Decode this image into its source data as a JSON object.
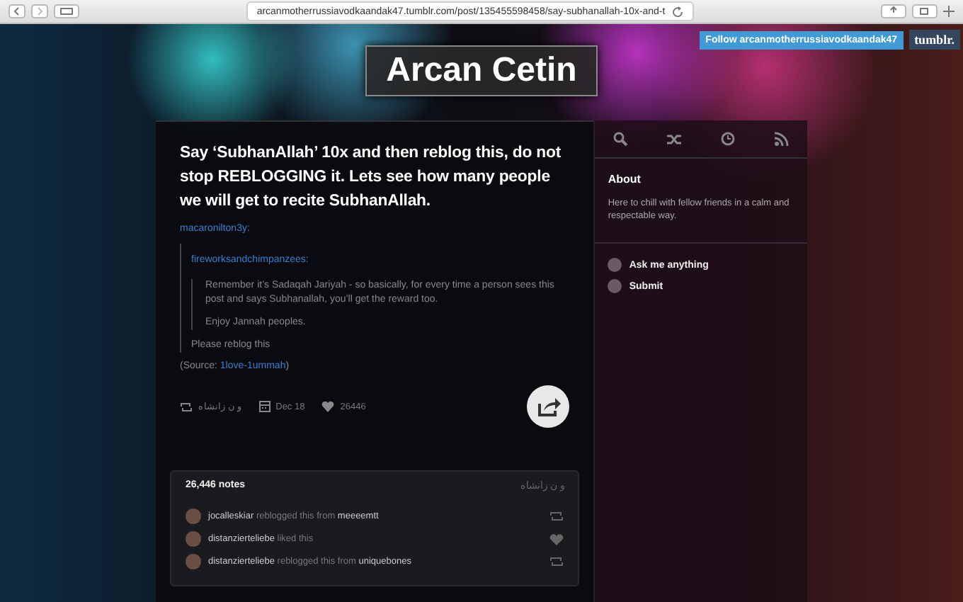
{
  "browser": {
    "url": "arcanmotherrussiavodkaandak47.tumblr.com/post/135455598458/say-subhanallah-10x-and-t"
  },
  "follow_bar": {
    "follow_label": "Follow arcanmotherrussiavodkaandak47",
    "brand": "tumblr."
  },
  "blog_title": "Arcan Cetin",
  "post": {
    "title": "Say ‘SubhanAllah’ 10x and then reblog this, do not stop REBLOGGING it. Lets see how many people we will get to recite SubhanAllah.",
    "reblogger": "macaronilton3y:",
    "quote": {
      "author": "fireworksandchimpanzees:",
      "paragraphs": [
        "Remember it’s Sadaqah Jariyah - so basically, for every time a person sees this post and says Subhanallah, you’ll get the reward too.",
        "Enjoy Jannah peoples."
      ]
    },
    "reblog_comment": "Please reblog this",
    "source_label": "(Source: ",
    "source_link": "1love-1ummah",
    "source_close": ")",
    "meta": {
      "via": "و ن زانشاه",
      "date": "Dec 18",
      "likes": "26446"
    }
  },
  "notes": {
    "count": "26,446 notes",
    "via": "و ن زانشاه",
    "items": [
      {
        "kind": "reblog",
        "user": "jocalleskiar",
        "action": " reblogged this from ",
        "from": "meeeemtt"
      },
      {
        "kind": "like",
        "user": "distanzierteliebe",
        "action": " liked this"
      },
      {
        "kind": "reblog",
        "user": "distanzierteliebe",
        "action": " reblogged this from ",
        "from": "uniquebones"
      }
    ]
  },
  "sidebar": {
    "about_title": "About",
    "about_text": "Here to chill with fellow friends in a calm and respectable way.",
    "links": [
      "Ask me anything",
      "Submit"
    ]
  }
}
